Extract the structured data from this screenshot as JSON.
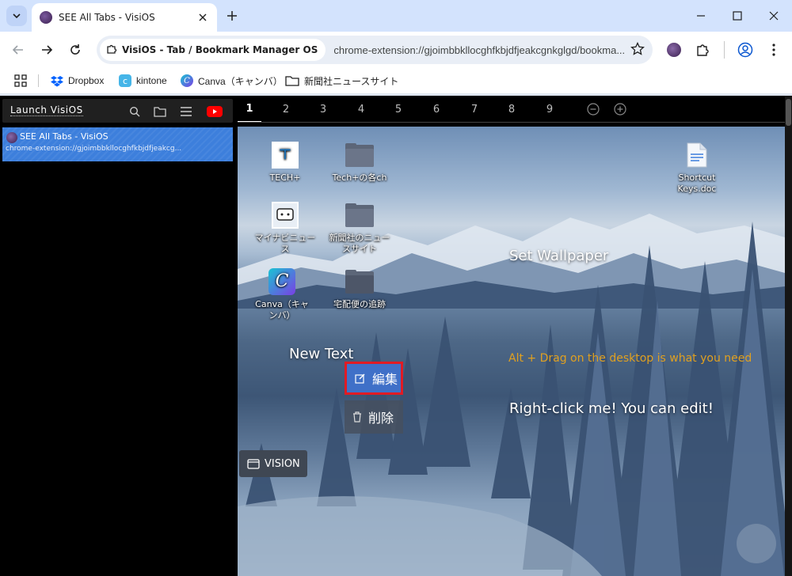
{
  "window": {
    "tab_title": "SEE All Tabs - VisiOS",
    "controls": [
      "minimize-icon",
      "maximize-icon",
      "close-icon"
    ]
  },
  "toolbar": {
    "site_chip": "VisiOS - Tab / Bookmark Manager OS",
    "url": "chrome-extension://gjoimbbkllocghfkbjdfjeakcgnkglgd/bookma..."
  },
  "bookmarks": [
    {
      "label": "Dropbox",
      "icon": "dropbox-icon"
    },
    {
      "label": "kintone",
      "icon": "kintone-icon"
    },
    {
      "label": "Canva（キャンバ）",
      "icon": "canva-icon"
    },
    {
      "label": "新聞社ニュースサイト",
      "icon": "folder-icon"
    }
  ],
  "sidebar": {
    "launch_label": "Launch VisiOS",
    "open_tab": {
      "title": "SEE All Tabs - VisiOS",
      "url": "chrome-extension://gjoimbbkllocghfkbjdfjeakcg..."
    }
  },
  "desktops": {
    "tabs": [
      "1",
      "2",
      "3",
      "4",
      "5",
      "6",
      "7",
      "8",
      "9"
    ],
    "active": "1"
  },
  "desktop": {
    "icons": {
      "tech": "TECH+",
      "tech_folder": "Tech+の各ch",
      "shortcut": "Shortcut Keys.doc",
      "mynavi": "マイナビニュース",
      "news_folder": "新聞社のニュースサイト",
      "canva": "Canva（キャンバ）",
      "takkyubin": "宅配便の追跡"
    },
    "texts": {
      "set_wallpaper": "Set Wallpaper",
      "hint": "Alt + Drag on the desktop is what you need",
      "right_click": "Right-click me! You can edit!",
      "new_text": "New Text"
    },
    "context_menu": {
      "edit": "編集",
      "delete": "削除"
    },
    "vision_button": "VISION"
  },
  "colors": {
    "accent_blue": "#3d7fdc",
    "highlight_red": "#e01b24",
    "hint_orange": "#e0a020"
  }
}
